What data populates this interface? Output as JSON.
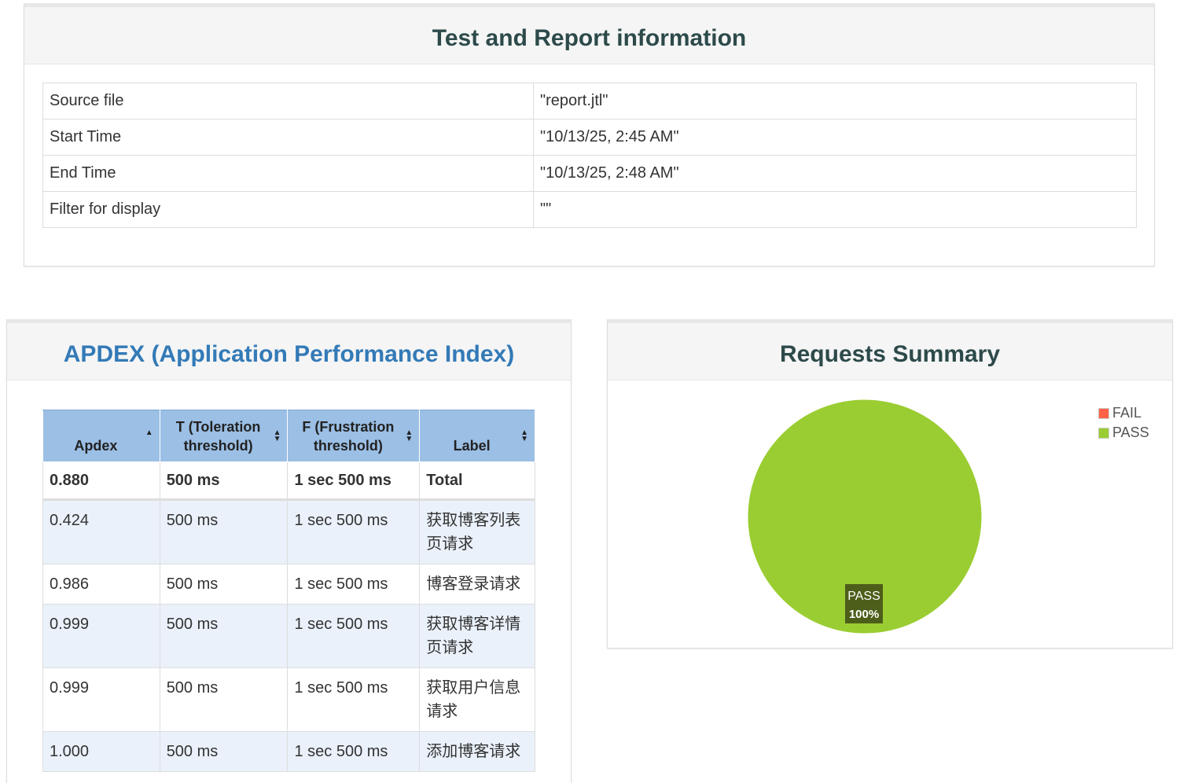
{
  "info_panel": {
    "title": "Test and Report information",
    "rows": [
      {
        "key": "Source file",
        "value": "\"report.jtl\""
      },
      {
        "key": "Start Time",
        "value": "\"10/13/25, 2:45 AM\""
      },
      {
        "key": "End Time",
        "value": "\"10/13/25, 2:48 AM\""
      },
      {
        "key": "Filter for display",
        "value": "\"\""
      }
    ]
  },
  "apdex_panel": {
    "title": "APDEX (Application Performance Index)",
    "headers": [
      "Apdex",
      "T (Toleration threshold)",
      "F (Frustration threshold)",
      "Label"
    ],
    "total": {
      "apdex": "0.880",
      "t": "500 ms",
      "f": "1 sec 500 ms",
      "label": "Total"
    },
    "rows": [
      {
        "apdex": "0.424",
        "t": "500 ms",
        "f": "1 sec 500 ms",
        "label": "获取博客列表页请求"
      },
      {
        "apdex": "0.986",
        "t": "500 ms",
        "f": "1 sec 500 ms",
        "label": "博客登录请求"
      },
      {
        "apdex": "0.999",
        "t": "500 ms",
        "f": "1 sec 500 ms",
        "label": "获取博客详情页请求"
      },
      {
        "apdex": "0.999",
        "t": "500 ms",
        "f": "1 sec 500 ms",
        "label": "获取用户信息请求"
      },
      {
        "apdex": "1.000",
        "t": "500 ms",
        "f": "1 sec 500 ms",
        "label": "添加博客请求"
      }
    ]
  },
  "summary_panel": {
    "title": "Requests Summary",
    "legend": [
      {
        "label": "FAIL",
        "color": "#ff6347"
      },
      {
        "label": "PASS",
        "color": "#9acd32"
      }
    ],
    "slice_label": "PASS",
    "slice_percent": "100%"
  },
  "chart_data": {
    "type": "pie",
    "title": "Requests Summary",
    "categories": [
      "FAIL",
      "PASS"
    ],
    "values": [
      0,
      100
    ],
    "colors": [
      "#ff6347",
      "#9acd32"
    ],
    "legend": "top-right"
  }
}
